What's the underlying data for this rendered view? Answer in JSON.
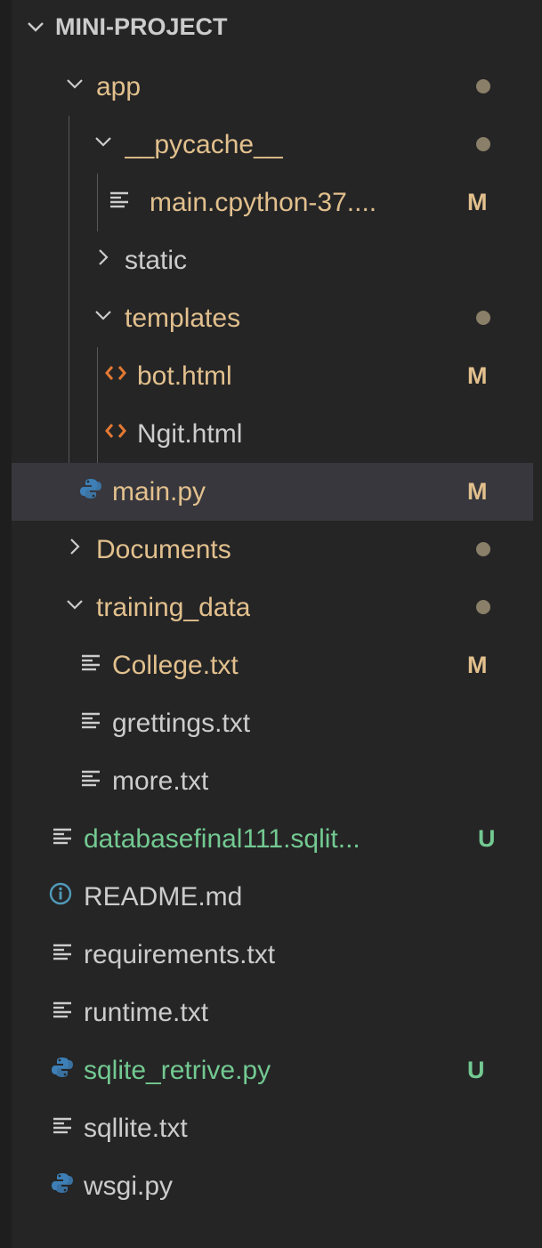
{
  "explorer": {
    "root_label": "MINI-PROJECT",
    "items": [
      {
        "label": "app",
        "name": "folder-app"
      },
      {
        "label": "__pycache__",
        "name": "folder-pycache"
      },
      {
        "label": "main.cpython-37....",
        "name": "file-main-cpython",
        "badge": "M"
      },
      {
        "label": "static",
        "name": "folder-static"
      },
      {
        "label": "templates",
        "name": "folder-templates"
      },
      {
        "label": "bot.html",
        "name": "file-bot-html",
        "badge": "M"
      },
      {
        "label": "Ngit.html",
        "name": "file-ngit-html"
      },
      {
        "label": "main.py",
        "name": "file-main-py",
        "badge": "M"
      },
      {
        "label": "Documents",
        "name": "folder-documents"
      },
      {
        "label": "training_data",
        "name": "folder-training-data"
      },
      {
        "label": "College.txt",
        "name": "file-college-txt",
        "badge": "M"
      },
      {
        "label": "grettings.txt",
        "name": "file-grettings-txt"
      },
      {
        "label": "more.txt",
        "name": "file-more-txt"
      },
      {
        "label": "databasefinal111.sqlit...",
        "name": "file-databasefinal",
        "badge": "U"
      },
      {
        "label": "README.md",
        "name": "file-readme"
      },
      {
        "label": "requirements.txt",
        "name": "file-requirements"
      },
      {
        "label": "runtime.txt",
        "name": "file-runtime"
      },
      {
        "label": "sqlite_retrive.py",
        "name": "file-sqlite-retrive",
        "badge": "U"
      },
      {
        "label": "sqllite.txt",
        "name": "file-sqllite-txt"
      },
      {
        "label": "wsgi.py",
        "name": "file-wsgi-py"
      }
    ]
  },
  "colors": {
    "background": "#252526",
    "text": "#cccccc",
    "modified": "#e2c08d",
    "untracked": "#73c991",
    "selected_row": "#37373d",
    "html_icon": "#e37933",
    "python_icon": "#3d7fb6",
    "info_icon": "#519aba"
  },
  "icons": {
    "expanded": "chevron-down-icon",
    "collapsed": "chevron-right-icon",
    "text_file": "lines-icon",
    "html_file": "angle-brackets-icon",
    "python_file": "python-icon",
    "markdown_file": "info-icon",
    "dirty_folder": "dot-icon"
  }
}
